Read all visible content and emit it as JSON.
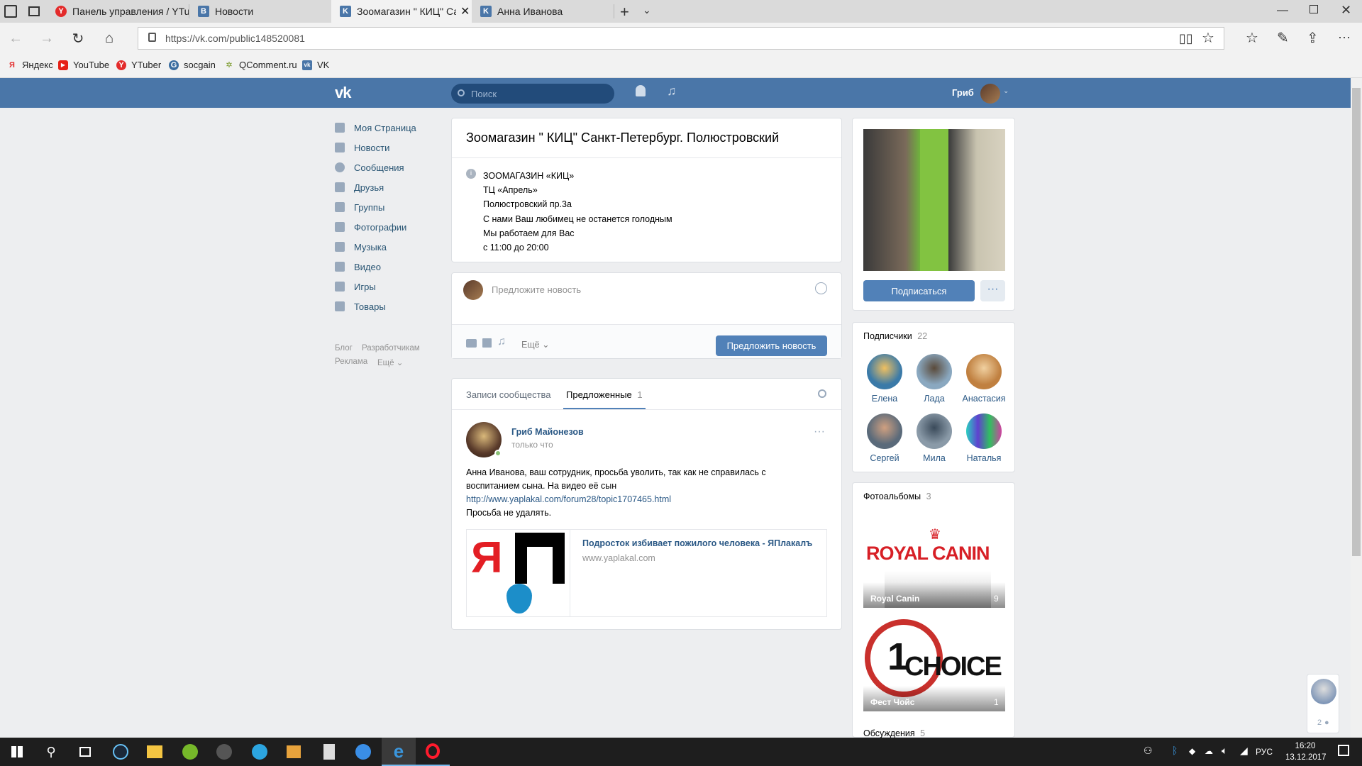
{
  "browser": {
    "tabs": [
      {
        "label": "Панель управления / YTub",
        "active": false
      },
      {
        "label": "Новости",
        "active": false
      },
      {
        "label": "Зоомагазин \" КИЦ\" Са",
        "active": true
      },
      {
        "label": "Анна Иванова",
        "active": false
      }
    ],
    "url": "https://vk.com/public148520081",
    "favorites": [
      "Яндекс",
      "YouTube",
      "YTuber",
      "socgain",
      "QComment.ru",
      "VK"
    ]
  },
  "vk": {
    "search_placeholder": "Поиск",
    "user_name": "Гриб",
    "menu": [
      "Моя Страница",
      "Новости",
      "Сообщения",
      "Друзья",
      "Группы",
      "Фотографии",
      "Музыка",
      "Видео",
      "Игры",
      "Товары"
    ],
    "footer_links": [
      "Блог",
      "Разработчикам",
      "Реклама",
      "Ещё"
    ],
    "group": {
      "title": "Зоомагазин \" КИЦ\" Санкт-Петербург. Полюстровский",
      "description": [
        "ЗООМАГАЗИН «КИЦ»",
        "ТЦ «Апрель»",
        "Полюстровский пр.3а",
        "С нами Ваш любимец не останется голодным",
        "Мы работаем для Вас",
        "с 11:00 до 20:00"
      ]
    },
    "composer": {
      "placeholder": "Предложите новость",
      "more": "Ещё",
      "submit": "Предложить новость"
    },
    "tabs": {
      "posts": "Записи сообщества",
      "suggested": "Предложенные",
      "suggested_count": "1"
    },
    "post": {
      "author": "Гриб Майонезов",
      "time": "только что",
      "text_1": "Анна Иванова, ваш сотрудник, просьба уволить, так как не справилась с",
      "text_2": "воспитанием сына. На видео её сын",
      "link": "http://www.yaplakal.com/forum28/topic1707465.html",
      "text_3": "Просьба не удалять.",
      "snippet_title": "Подросток избивает пожилого человека - ЯПлакалъ",
      "snippet_domain": "www.yaplakal.com"
    },
    "sidebar": {
      "subscribe": "Подписаться",
      "subscribers_label": "Подписчики",
      "subscribers_count": "22",
      "subscribers": [
        "Елена",
        "Лада",
        "Анастасия",
        "Сергей",
        "Мила",
        "Наталья"
      ],
      "albums_label": "Фотоальбомы",
      "albums_count": "3",
      "albums": [
        {
          "name": "Royal Canin",
          "count": "9",
          "logo": "ROYAL CANIN"
        },
        {
          "name": "Фест Чойс",
          "count": "1",
          "logo": "CHOICE"
        }
      ],
      "discussions_label": "Обсуждения",
      "discussions_count": "5",
      "chat_count": "2"
    }
  },
  "taskbar": {
    "time": "16:20",
    "date": "13.12.2017",
    "lang": "РУС"
  }
}
